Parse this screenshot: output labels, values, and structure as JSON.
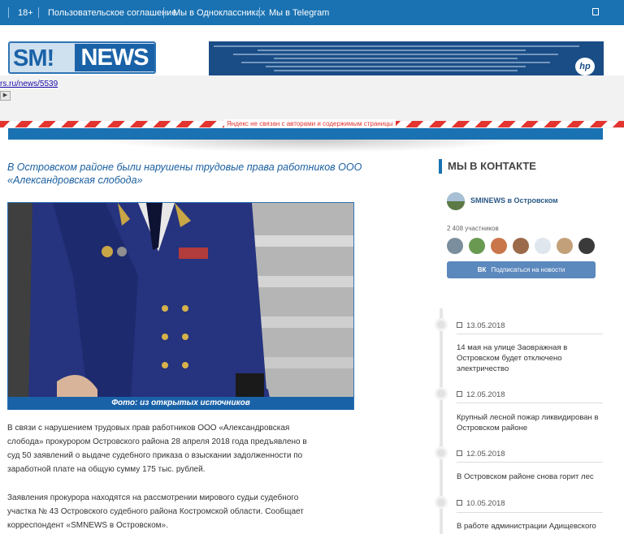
{
  "topbar": {
    "age": "18+",
    "links": [
      "Пользовательское соглашение",
      "Мы в Одноклассниках",
      "Мы в Telegram"
    ]
  },
  "logo": {
    "left": "SM!",
    "right": "NEWS"
  },
  "ad": {
    "brand": "hp"
  },
  "cache": {
    "url": "rs.ru/news/5539",
    "play_glyph": "▶",
    "notice": "Яндекс не связан с авторами и содержимым страницы"
  },
  "article": {
    "title": "В Островском районе были нарушены трудовые права работников ООО «Александровская слобода»",
    "caption": "Фото: из открытых источников",
    "paragraphs": [
      "В связи с нарушением трудовых прав работников ООО «Александровская слобода» прокурором Островского района 28 апреля 2018 года предъявлено в суд 50 заявлений о выдаче судебного приказа о взыскании задолженности по заработной плате на общую сумму 175 тыс. рублей.",
      "Заявления прокурора находятся на рассмотрении мирового судьи судебного участка № 43 Островского судебного района Костромской области. Сообщает корреспондент «SMNEWS в Островском»."
    ]
  },
  "sidebar": {
    "vk_heading": "МЫ В КОНТАКТЕ",
    "vk_group": "SMINEWS в Островском",
    "vk_members": "2 408 участников",
    "vk_button_logo": "ВК",
    "vk_button": "Подписаться на новости",
    "news": [
      {
        "date": "13.05.2018",
        "text": "14 мая на улице Заовражная в Островском будет отключено электричество"
      },
      {
        "date": "12.05.2018",
        "text": "Крупный лесной пожар ликвидирован в Островском районе"
      },
      {
        "date": "12.05.2018",
        "text": "В Островском районе снова горит лес"
      },
      {
        "date": "10.05.2018",
        "text": "В работе администрации Адищевского"
      }
    ]
  },
  "colors": {
    "brand_blue": "#1a72b2",
    "title_blue": "#1a5fa0",
    "vk_blue": "#5b88bd",
    "stripe_red": "#e3342f"
  }
}
